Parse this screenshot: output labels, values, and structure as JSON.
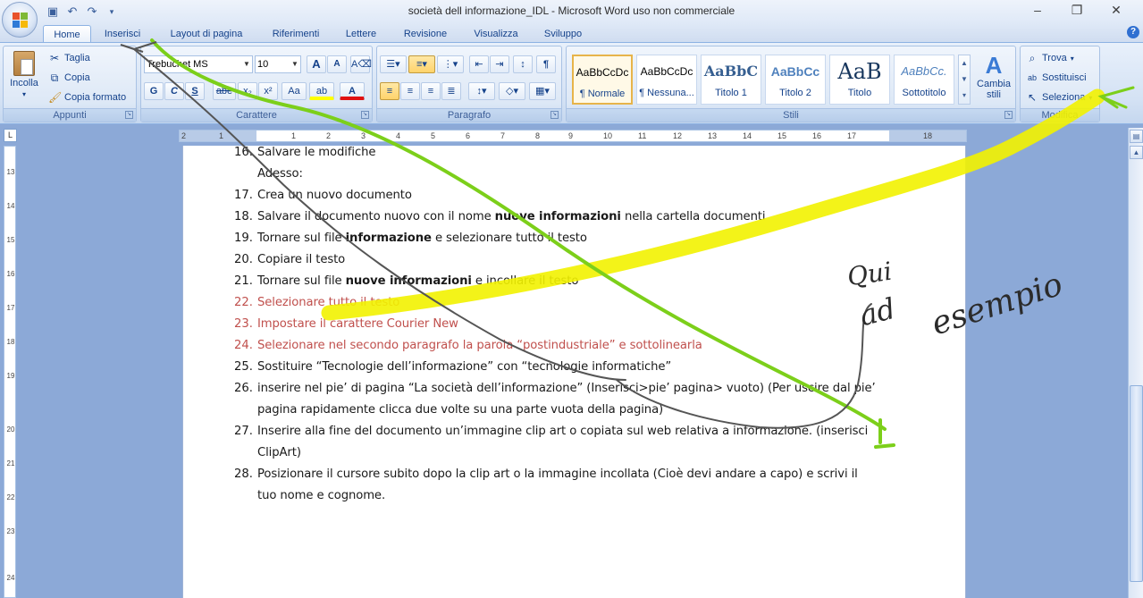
{
  "window": {
    "title": "società dell informazione_IDL - Microsoft Word uso non commerciale",
    "controls": [
      "–",
      "❐",
      "✕"
    ]
  },
  "tabs": [
    "Home",
    "Inserisci",
    "Layout di pagina",
    "Riferimenti",
    "Lettere",
    "Revisione",
    "Visualizza",
    "Sviluppo"
  ],
  "active_tab": "Home",
  "ribbon": {
    "appunti": {
      "label": "Appunti",
      "incolla": "Incolla",
      "taglia": "Taglia",
      "copia": "Copia",
      "copia_formato": "Copia formato"
    },
    "carattere": {
      "label": "Carattere",
      "font_name": "Trebuchet MS",
      "font_size": "10",
      "bold": "G",
      "italic": "C",
      "underline": "S",
      "strike": "abe",
      "subscript": "x₂",
      "superscript": "x²",
      "change_case": "Aa",
      "grow": "A",
      "shrink": "A"
    },
    "paragrafo": {
      "label": "Paragrafo"
    },
    "stili": {
      "label": "Stili",
      "items": [
        {
          "sample": "AaBbCcDc",
          "name": "¶ Normale"
        },
        {
          "sample": "AaBbCcDc",
          "name": "¶ Nessuna..."
        },
        {
          "sample": "AaBbC",
          "name": "Titolo 1"
        },
        {
          "sample": "AaBbCc",
          "name": "Titolo 2"
        },
        {
          "sample": "AaB",
          "name": "Titolo"
        },
        {
          "sample": "AaBbCc.",
          "name": "Sottotitolo"
        }
      ],
      "cambia_stili": "Cambia stili"
    },
    "modifica": {
      "label": "Modifica",
      "trova": "Trova",
      "sostituisci": "Sostituisci",
      "seleziona": "Seleziona"
    }
  },
  "ruler": {
    "ticks": [
      "2",
      "1",
      "1",
      "2",
      "3",
      "4",
      "5",
      "6",
      "7",
      "8",
      "9",
      "10",
      "11",
      "12",
      "13",
      "14",
      "15",
      "16",
      "17",
      "18"
    ]
  },
  "vruler": {
    "ticks": [
      "13",
      "14",
      "15",
      "16",
      "17",
      "18",
      "19",
      "20",
      "21",
      "22",
      "23",
      "24"
    ]
  },
  "document": {
    "lines": [
      {
        "num": "16.",
        "text": "Salvare le modifiche"
      },
      {
        "num": "",
        "text": "Adesso:"
      },
      {
        "num": "17.",
        "text": "Crea un nuovo documento"
      },
      {
        "num": "18.",
        "pre": "Salvare il documento nuovo con il nome ",
        "bold": "nuove informazioni",
        "post": " nella cartella documenti"
      },
      {
        "num": "19.",
        "pre": "Tornare sul file ",
        "bold": "informazione",
        "post": " e selezionare tutto il testo"
      },
      {
        "num": "20.",
        "text": "Copiare il testo"
      },
      {
        "num": "21.",
        "pre": "Tornare sul file ",
        "bold": "nuove informazioni",
        "post": " e incollare il testo"
      },
      {
        "num": "22.",
        "text": "Selezionare tutto il testo",
        "color": "red"
      },
      {
        "num": "23.",
        "text": "Impostare il carattere Courier New",
        "color": "red"
      },
      {
        "num": "24.",
        "text": "Selezionare nel secondo paragrafo la parola “postindustriale” e sottolinearla",
        "color": "red"
      },
      {
        "num": "25.",
        "text": "Sostituire “Tecnologie dell’informazione” con “tecnologie informatiche”"
      },
      {
        "num": "26.",
        "text": "inserire nel pie’ di pagina “La società dell’informazione” (Inserisci>pie’ pagina> vuoto) (Per uscire dal pie’"
      },
      {
        "num": "",
        "text": "pagina rapidamente clicca due volte su una parte vuota della pagina)"
      },
      {
        "num": "27.",
        "text": "Inserire alla fine del documento un’immagine clip art o copiata sul web relativa a informazione. (inserisci"
      },
      {
        "num": "",
        "text": "ClipArt)"
      },
      {
        "num": "28.",
        "text": "Posizionare il cursore subito dopo la clip art  o la immagine incollata (Cioè devi andare a capo)   e scrivi il"
      },
      {
        "num": "",
        "text": "tuo nome e cognome."
      }
    ]
  },
  "handwriting": {
    "word1": "Qui",
    "word2": "ad",
    "word3": "esempio"
  },
  "colors": {
    "yellow_highlight": "#f2f200",
    "green_stroke": "#7ccf1a",
    "pen_stroke": "#555555"
  }
}
